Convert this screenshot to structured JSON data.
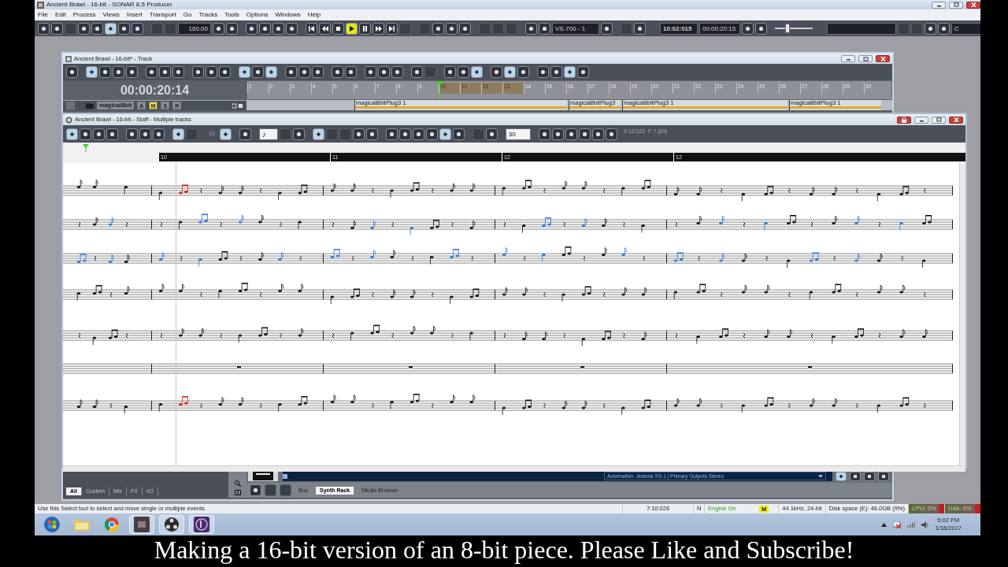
{
  "app": {
    "title": "Ancient Brawl - 16-bit - SONAR 8.5 Producer"
  },
  "menu": [
    "File",
    "Edit",
    "Process",
    "Views",
    "Insert",
    "Transport",
    "Go",
    "Tracks",
    "Tools",
    "Options",
    "Windows",
    "Help"
  ],
  "control_bar": {
    "tempo": "160.00",
    "play_on": true,
    "output_port": "VS-700 - 1",
    "now_mbt": "10:02:015",
    "now_time": "00:00:20:15",
    "scrub": {
      "level": 0.3
    },
    "key": "C"
  },
  "track_view": {
    "title": "Ancient Brawl - 16-bit* - Track",
    "now_time": "00:00:20:14",
    "ruler": [
      {
        "label": "1",
        "selected": false
      },
      {
        "label": "2",
        "selected": false
      },
      {
        "label": "3",
        "selected": false
      },
      {
        "label": "4",
        "selected": false
      },
      {
        "label": "5",
        "selected": false
      },
      {
        "label": "6",
        "selected": false
      },
      {
        "label": "7",
        "selected": false
      },
      {
        "label": "8",
        "selected": false
      },
      {
        "label": "9",
        "selected": false
      },
      {
        "label": "10",
        "selected": true
      },
      {
        "label": "11",
        "selected": true
      },
      {
        "label": "12",
        "selected": true
      },
      {
        "label": "13",
        "selected": true
      },
      {
        "label": "14",
        "selected": false
      },
      {
        "label": "15",
        "selected": false
      },
      {
        "label": "16",
        "selected": false
      },
      {
        "label": "17",
        "selected": false
      },
      {
        "label": "18",
        "selected": false
      },
      {
        "label": "19",
        "selected": false
      },
      {
        "label": "20",
        "selected": false
      },
      {
        "label": "21",
        "selected": false
      },
      {
        "label": "22",
        "selected": false
      },
      {
        "label": "23",
        "selected": false
      },
      {
        "label": "24",
        "selected": false
      },
      {
        "label": "25",
        "selected": false
      },
      {
        "label": "26",
        "selected": false
      },
      {
        "label": "27",
        "selected": false
      },
      {
        "label": "28",
        "selected": false
      },
      {
        "label": "29",
        "selected": false
      },
      {
        "label": "30",
        "selected": false
      }
    ],
    "tracks": [
      {
        "name": "magical8bit",
        "buttons": [
          {
            "label": "A",
            "on": false
          },
          {
            "label": "M",
            "on": true
          },
          {
            "label": "S",
            "on": false
          },
          {
            "label": "R",
            "on": false
          }
        ]
      }
    ],
    "clips": [
      {
        "label": "magical8bitPlug3 1"
      },
      {
        "label": "magical8bitPlug3"
      },
      {
        "label": "magical8bitPlug3 1"
      },
      {
        "label": "magical8bitPlug3 1"
      }
    ],
    "strip_tabs": [
      {
        "label": "All",
        "selected": true
      },
      {
        "label": "Custom",
        "selected": false
      },
      {
        "label": "Mix",
        "selected": false
      },
      {
        "label": "FX",
        "selected": false
      },
      {
        "label": "I/O",
        "selected": false
      }
    ],
    "browser_tabs": [
      {
        "label": "Bus",
        "selected": false
      },
      {
        "label": "Synth Rack",
        "selected": true
      },
      {
        "label": "Media Browser",
        "selected": false
      }
    ],
    "automation": "Automation: Jeskola XS-1 | Primary Outputs Stereo"
  },
  "staff_view": {
    "title": "Ancient Brawl - 16-bit - Staff - Multiple tracks",
    "zoom": "33",
    "note_value": "♪",
    "resolution": "30",
    "position": "9:12:022  F 7 (89)",
    "measures": [
      "10",
      "11",
      "12",
      "12"
    ]
  },
  "status_bar": {
    "hint": "Use this Select tool to select and move single or multiple events.",
    "time": "7:10:026",
    "mode": "N",
    "engine": "Engine On",
    "marker": "M",
    "format": "44.1kHz, 24-bit",
    "disk_space": "Disk space (E): 46.0GB (9%)",
    "cpu": "CPU: 0%",
    "disk": "Disk: 0%"
  },
  "taskbar": {
    "time": "5:02 PM",
    "date": "1/16/2017"
  },
  "caption": "Making a 16-bit version of an 8-bit piece. Please Like and Subscribe!"
}
